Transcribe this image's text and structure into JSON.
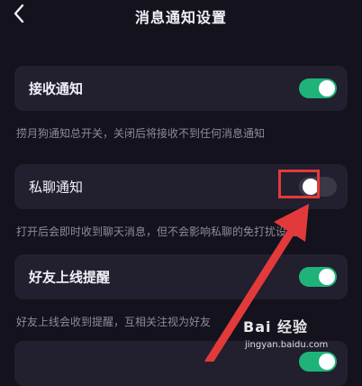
{
  "header": {
    "title": "消息通知设置",
    "back_icon": "chevron-left-icon"
  },
  "settings": [
    {
      "label": "接收通知",
      "enabled": true,
      "description": "捞月狗通知总开关，关闭后将接收不到任何消息通知"
    },
    {
      "label": "私聊通知",
      "enabled": false,
      "description": "打开后会即时收到聊天消息，但不会影响私聊的免打扰设置"
    },
    {
      "label": "好友上线提醒",
      "enabled": true,
      "description": "好友上线会收到提醒，互相关注视为好友"
    },
    {
      "label": "",
      "enabled": true,
      "description": ""
    }
  ],
  "colors": {
    "background": "#14121d",
    "card": "#221f2f",
    "toggle_on": "#1fb37a",
    "toggle_off": "#3b3846",
    "annotation": "#e23a3a"
  },
  "watermark": {
    "logo_text": "Bai 经验",
    "url": "jingyan.baidu.com"
  }
}
